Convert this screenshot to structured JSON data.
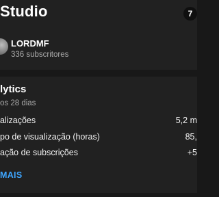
{
  "header": {
    "title": "Studio",
    "notification_count": "7"
  },
  "channel": {
    "name": "LORDMF",
    "subscribers": "336 subscritores"
  },
  "analytics": {
    "title": "lytics",
    "period": "os 28 dias",
    "metrics": [
      {
        "label": "alizações",
        "value": "5,2 m"
      },
      {
        "label": "po de visualização (horas)",
        "value": "85,"
      },
      {
        "label": "ação de subscrições",
        "value": "+5"
      }
    ],
    "more_label": "MAIS"
  }
}
